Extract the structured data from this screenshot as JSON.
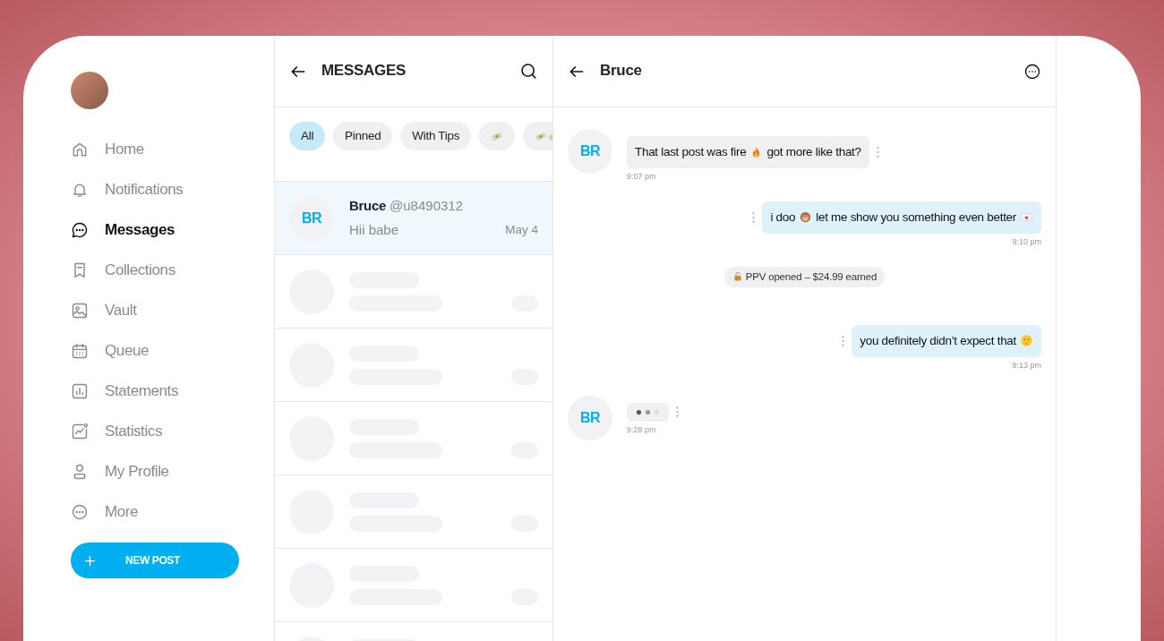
{
  "sidebar": {
    "items": [
      {
        "label": "Home",
        "selected": false
      },
      {
        "label": "Notifications",
        "selected": false
      },
      {
        "label": "Messages",
        "selected": true
      },
      {
        "label": "Collections",
        "selected": false
      },
      {
        "label": "Vault",
        "selected": false
      },
      {
        "label": "Queue",
        "selected": false
      },
      {
        "label": "Statements",
        "selected": false
      },
      {
        "label": "Statistics",
        "selected": false
      },
      {
        "label": "My Profile",
        "selected": false
      },
      {
        "label": "More",
        "selected": false
      }
    ],
    "new_post": "NEW POST"
  },
  "messages_panel": {
    "title": "MESSAGES",
    "filters": [
      {
        "kind": "text",
        "label": "All",
        "selected": true
      },
      {
        "kind": "text",
        "label": "Pinned",
        "selected": false
      },
      {
        "kind": "text",
        "label": "With Tips",
        "selected": false
      },
      {
        "kind": "icon",
        "selected": false
      },
      {
        "kind": "icon",
        "selected": false
      }
    ],
    "conversations": [
      {
        "initials": "BR",
        "name": "Bruce",
        "handle": "@u8490312",
        "preview": "Hii babe",
        "date": "May 4",
        "selected": true
      }
    ],
    "loading": true
  },
  "chat": {
    "title": "Bruce",
    "messages": [
      {
        "kind": "incoming",
        "initials": "BR",
        "parts": [
          {
            "kind": "text",
            "text": "That last post was fire"
          },
          {
            "kind": "emoji"
          },
          {
            "kind": "text",
            "text": "got more like that?"
          }
        ],
        "time": "9:07 pm"
      },
      {
        "kind": "outgoing",
        "parts": [
          {
            "kind": "text",
            "text": "i doo"
          },
          {
            "kind": "emoji"
          },
          {
            "kind": "text",
            "text": "let me show you something even better"
          },
          {
            "kind": "emoji"
          }
        ],
        "time": "9:10 pm"
      },
      {
        "kind": "event",
        "parts": [
          {
            "kind": "emoji"
          },
          {
            "kind": "text",
            "text": "PPV opened – $24.99 earned"
          }
        ]
      },
      {
        "kind": "outgoing",
        "parts": [
          {
            "kind": "text",
            "text": "you definitely didn’t expect that"
          },
          {
            "kind": "emoji"
          }
        ],
        "time": "9:13 pm"
      },
      {
        "kind": "typing",
        "initials": "BR",
        "time": "9:28 pm"
      }
    ]
  }
}
